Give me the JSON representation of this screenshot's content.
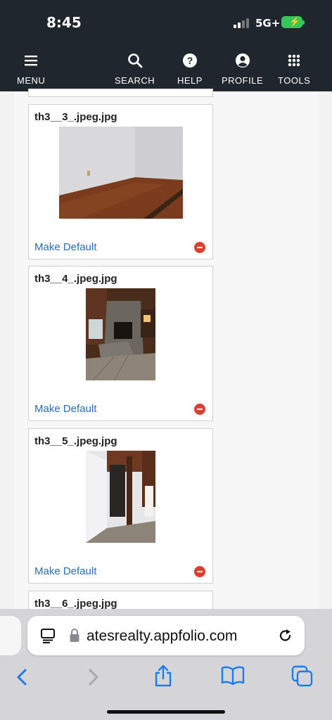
{
  "status": {
    "time": "8:45",
    "network": "5G+"
  },
  "nav": {
    "menu": "MENU",
    "search": "SEARCH",
    "help": "HELP",
    "profile": "PROFILE",
    "tools": "TOOLS"
  },
  "photos": [
    {
      "filename": "th3__3_.jpeg.jpg",
      "action": "Make Default"
    },
    {
      "filename": "th3__4_.jpeg.jpg",
      "action": "Make Default"
    },
    {
      "filename": "th3__5_.jpeg.jpg",
      "action": "Make Default"
    },
    {
      "filename": "th3__6_.jpeg.jpg"
    }
  ],
  "browser": {
    "url": "atesrealty.appfolio.com"
  },
  "colors": {
    "nav_bg": "#1f262d",
    "link": "#2a6db4",
    "remove": "#d9402e",
    "toolbar_blue": "#1a7cf5"
  }
}
